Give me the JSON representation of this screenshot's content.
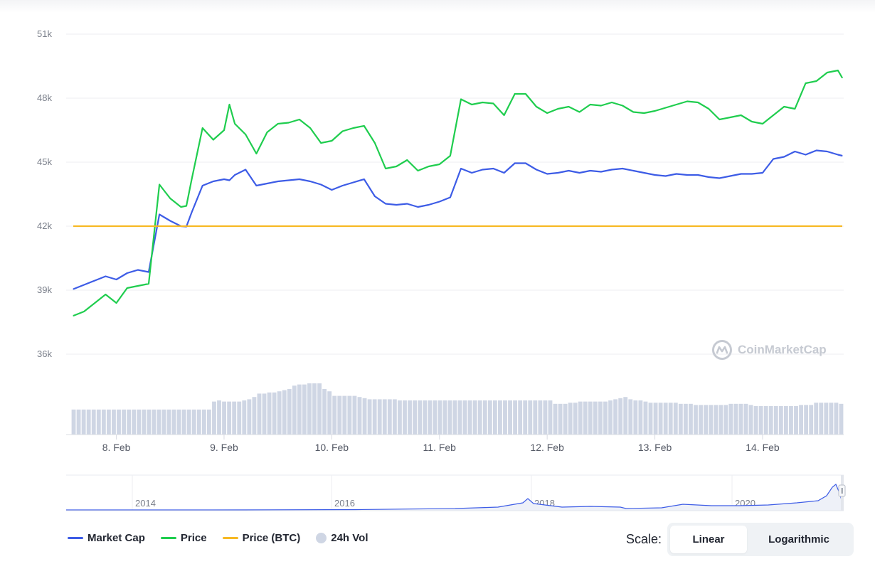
{
  "colors": {
    "market_cap": "#3d5ce6",
    "price": "#1fcd4e",
    "price_btc": "#f7b924",
    "volume": "#cfd6e4",
    "grid": "#eceef2"
  },
  "watermark": "CoinMarketCap",
  "legend": [
    {
      "label": "Market Cap",
      "color": "#3d5ce6",
      "kind": "line"
    },
    {
      "label": "Price",
      "color": "#1fcd4e",
      "kind": "line"
    },
    {
      "label": "Price (BTC)",
      "color": "#f7b924",
      "kind": "line"
    },
    {
      "label": "24h Vol",
      "color": "#cfd6e4",
      "kind": "dot"
    }
  ],
  "scale": {
    "label": "Scale:",
    "options": [
      "Linear",
      "Logarithmic"
    ],
    "selected": "Linear"
  },
  "chart_data": {
    "type": "line",
    "title": "",
    "x_range": [
      7.6,
      14.74
    ],
    "ylim": [
      36000,
      51000
    ],
    "y_ticks": [
      "51k",
      "48k",
      "45k",
      "42k",
      "39k",
      "36k"
    ],
    "y_tick_values": [
      51000,
      48000,
      45000,
      42000,
      39000,
      36000
    ],
    "x_ticks": [
      "8. Feb",
      "9. Feb",
      "10. Feb",
      "11. Feb",
      "12. Feb",
      "13. Feb",
      "14. Feb"
    ],
    "x_tick_values": [
      8,
      9,
      10,
      11,
      12,
      13,
      14
    ],
    "grid": true,
    "legend_position": "bottom-left",
    "series": [
      {
        "name": "Market Cap",
        "x": [
          7.6,
          7.7,
          7.8,
          7.9,
          8.0,
          8.1,
          8.2,
          8.3,
          8.4,
          8.5,
          8.6,
          8.65,
          8.7,
          8.8,
          8.9,
          9.0,
          9.05,
          9.1,
          9.2,
          9.3,
          9.4,
          9.5,
          9.6,
          9.7,
          9.8,
          9.9,
          10.0,
          10.1,
          10.2,
          10.3,
          10.4,
          10.5,
          10.6,
          10.7,
          10.8,
          10.9,
          11.0,
          11.1,
          11.2,
          11.3,
          11.4,
          11.5,
          11.6,
          11.7,
          11.8,
          11.9,
          12.0,
          12.1,
          12.2,
          12.3,
          12.4,
          12.5,
          12.6,
          12.7,
          12.8,
          12.9,
          13.0,
          13.1,
          13.2,
          13.3,
          13.4,
          13.5,
          13.6,
          13.7,
          13.8,
          13.9,
          14.0,
          14.1,
          14.2,
          14.3,
          14.4,
          14.5,
          14.6,
          14.7,
          14.74
        ],
        "values": [
          39050,
          39250,
          39450,
          39650,
          39500,
          39800,
          39950,
          39850,
          42550,
          42250,
          42000,
          41980,
          42650,
          43900,
          44100,
          44200,
          44150,
          44400,
          44650,
          43900,
          44000,
          44100,
          44150,
          44200,
          44100,
          43950,
          43700,
          43900,
          44050,
          44200,
          43400,
          43050,
          43000,
          43050,
          42900,
          43000,
          43150,
          43350,
          44700,
          44500,
          44650,
          44700,
          44500,
          44950,
          44950,
          44650,
          44450,
          44500,
          44600,
          44500,
          44600,
          44550,
          44650,
          44700,
          44600,
          44500,
          44400,
          44350,
          44450,
          44400,
          44400,
          44300,
          44250,
          44350,
          44450,
          44450,
          44500,
          45150,
          45250,
          45500,
          45350,
          45550,
          45500,
          45350,
          45300
        ]
      },
      {
        "name": "Price",
        "x": [
          7.6,
          7.7,
          7.8,
          7.9,
          8.0,
          8.1,
          8.2,
          8.3,
          8.4,
          8.5,
          8.6,
          8.65,
          8.7,
          8.8,
          8.9,
          9.0,
          9.05,
          9.1,
          9.2,
          9.3,
          9.4,
          9.5,
          9.6,
          9.7,
          9.8,
          9.9,
          10.0,
          10.1,
          10.2,
          10.3,
          10.4,
          10.5,
          10.6,
          10.7,
          10.8,
          10.9,
          11.0,
          11.1,
          11.2,
          11.3,
          11.4,
          11.5,
          11.6,
          11.7,
          11.8,
          11.9,
          12.0,
          12.1,
          12.2,
          12.3,
          12.4,
          12.5,
          12.6,
          12.7,
          12.8,
          12.9,
          13.0,
          13.1,
          13.2,
          13.3,
          13.4,
          13.5,
          13.6,
          13.7,
          13.8,
          13.9,
          14.0,
          14.1,
          14.2,
          14.3,
          14.4,
          14.5,
          14.6,
          14.7,
          14.74
        ],
        "values": [
          37800,
          38000,
          38400,
          38800,
          38400,
          39100,
          39200,
          39300,
          43950,
          43300,
          42900,
          42950,
          44200,
          46600,
          46050,
          46500,
          47700,
          46800,
          46300,
          45400,
          46400,
          46800,
          46850,
          47000,
          46600,
          45900,
          46000,
          46450,
          46600,
          46700,
          45900,
          44700,
          44800,
          45100,
          44600,
          44800,
          44900,
          45300,
          47950,
          47700,
          47800,
          47750,
          47200,
          48200,
          48200,
          47600,
          47300,
          47500,
          47600,
          47350,
          47700,
          47650,
          47800,
          47650,
          47350,
          47300,
          47400,
          47550,
          47700,
          47850,
          47800,
          47500,
          47000,
          47100,
          47200,
          46900,
          46800,
          47200,
          47600,
          47500,
          48700,
          48800,
          49200,
          49300,
          48950
        ]
      },
      {
        "name": "Price (BTC)",
        "x": [
          7.6,
          14.74
        ],
        "values": [
          42000,
          42000
        ]
      }
    ],
    "volume_bars": [
      22,
      22,
      22,
      22,
      22,
      22,
      22,
      22,
      22,
      22,
      22,
      22,
      22,
      22,
      22,
      22,
      22,
      22,
      22,
      22,
      22,
      22,
      22,
      22,
      22,
      22,
      22,
      22,
      29,
      30,
      29,
      29,
      29,
      29,
      30,
      31,
      33,
      36,
      36,
      37,
      37,
      38,
      39,
      40,
      43,
      44,
      44,
      45,
      45,
      45,
      40,
      38,
      34,
      34,
      34,
      34,
      34,
      33,
      32,
      31,
      31,
      31,
      31,
      31,
      31,
      30,
      30,
      30,
      30,
      30,
      30,
      30,
      30,
      30,
      30,
      30,
      30,
      30,
      30,
      30,
      30,
      30,
      30,
      30,
      30,
      30,
      30,
      30,
      30,
      30,
      30,
      30,
      30,
      30,
      30,
      30,
      27,
      27,
      27,
      28,
      28,
      29,
      29,
      29,
      29,
      29,
      29,
      30,
      31,
      32,
      33,
      31,
      30,
      30,
      29,
      28,
      28,
      28,
      28,
      28,
      28,
      27,
      27,
      27,
      26,
      26,
      26,
      26,
      26,
      26,
      26,
      27,
      27,
      27,
      27,
      26,
      25,
      25,
      25,
      25,
      25,
      25,
      25,
      25,
      25,
      26,
      26,
      26,
      28,
      28,
      28,
      28,
      28,
      27
    ],
    "navigator": {
      "labels": [
        "2014",
        "2016",
        "2018",
        "2020"
      ]
    }
  }
}
